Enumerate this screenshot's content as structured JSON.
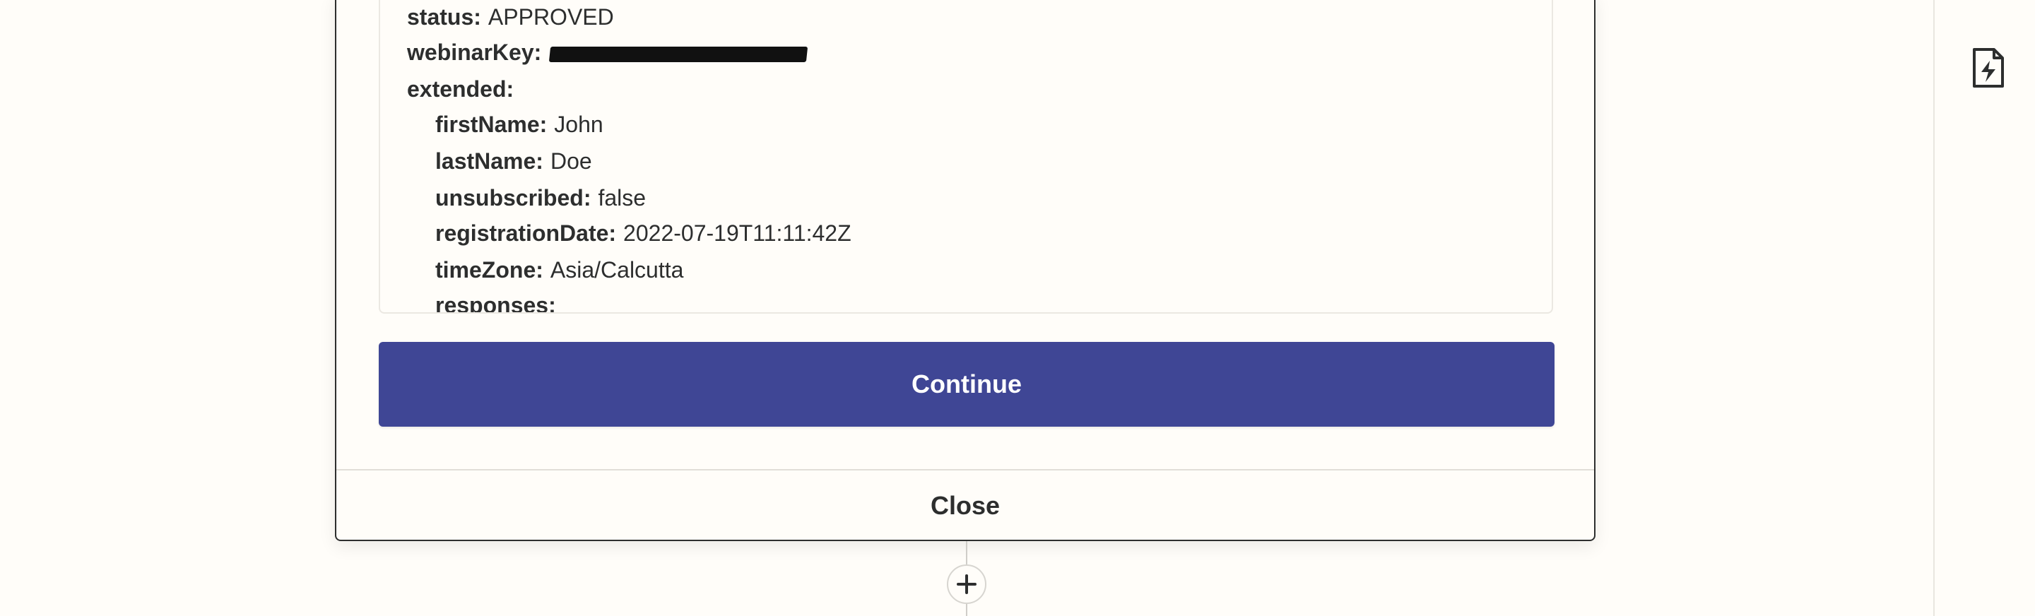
{
  "record": {
    "status_key": "status:",
    "status_value": "APPROVED",
    "webinar_key": "webinarKey:",
    "extended_key": "extended:",
    "first_name_key": "firstName:",
    "first_name_value": "John",
    "last_name_key": "lastName:",
    "last_name_value": "Doe",
    "unsubscribed_key": "unsubscribed:",
    "unsubscribed_value": "false",
    "registration_date_key": "registrationDate:",
    "registration_date_value": "2022-07-19T11:11:42Z",
    "time_zone_key": "timeZone:",
    "time_zone_value": "Asia/Calcutta",
    "responses_key": "responses:"
  },
  "actions": {
    "continue_label": "Continue",
    "close_label": "Close"
  },
  "icons": {
    "add_step": "plus-icon",
    "rail_top": "chevron-icon",
    "rail_zap": "zap-file-icon"
  },
  "colors": {
    "accent": "#3f4695",
    "background": "#fffdf9",
    "text": "#2d2e2e"
  }
}
